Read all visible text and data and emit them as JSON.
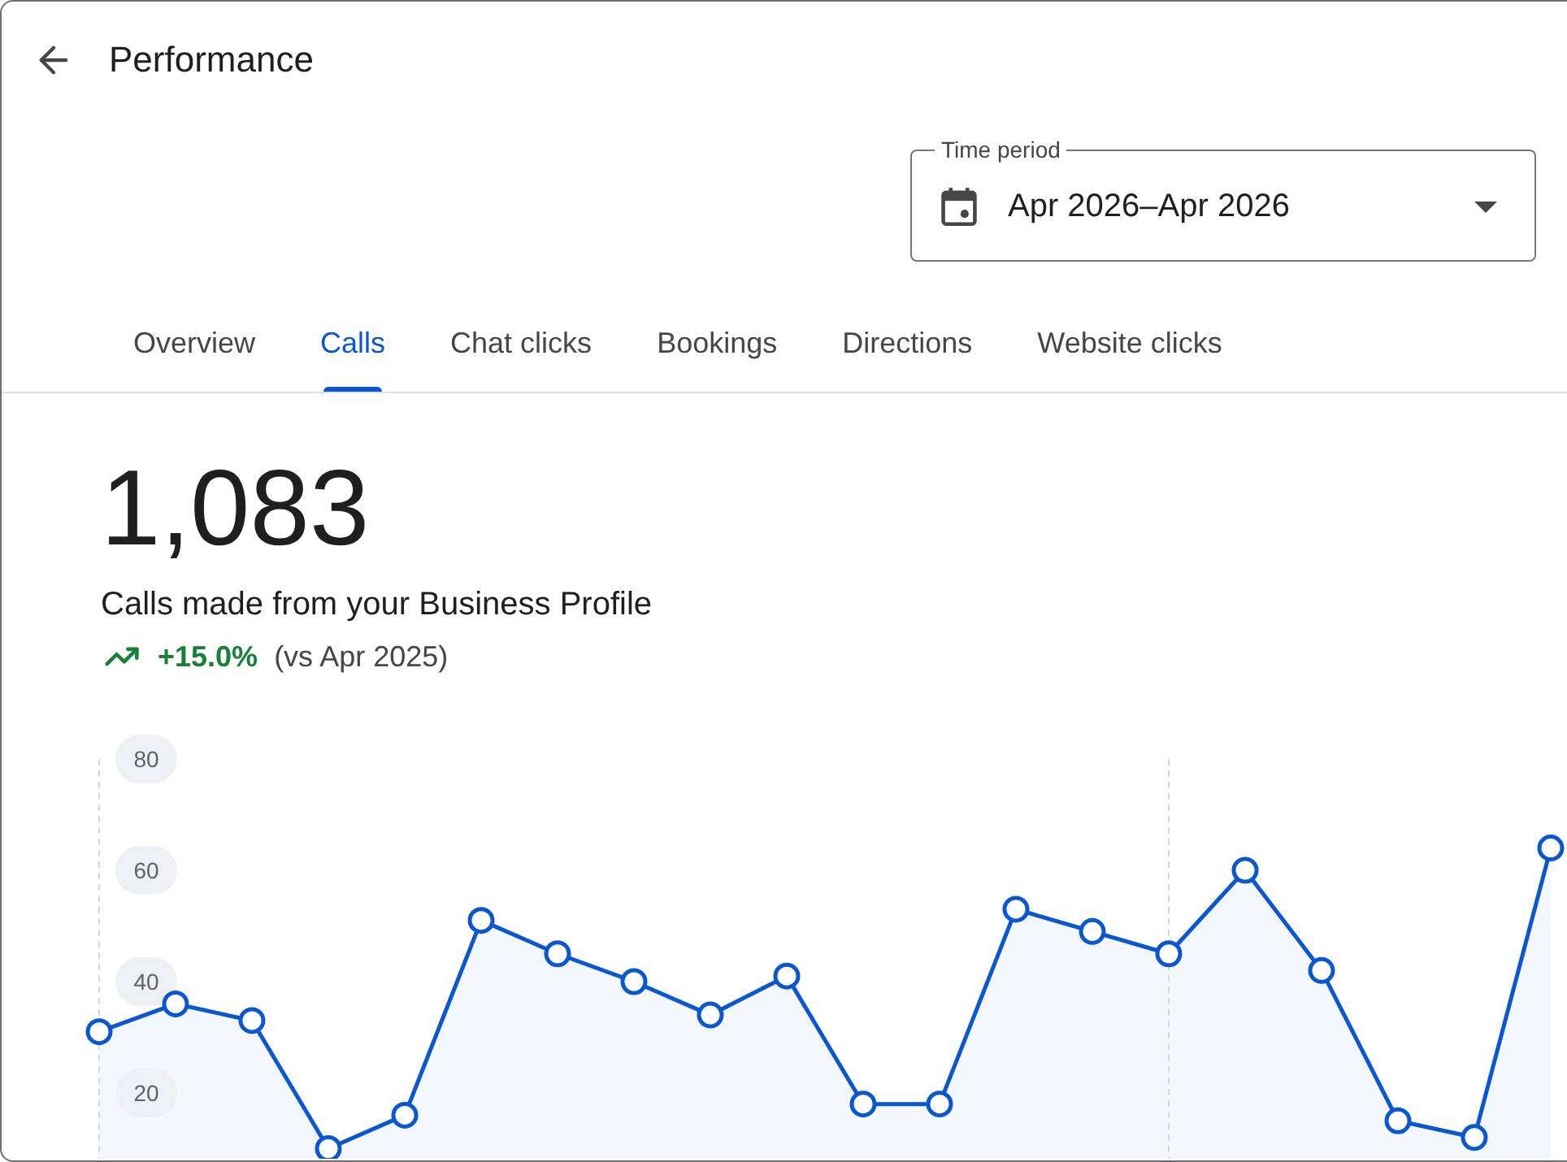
{
  "header": {
    "title": "Performance"
  },
  "time_period": {
    "label": "Time period",
    "value": "Apr 2026–Apr 2026"
  },
  "tabs": [
    {
      "label": "Overview",
      "selected": false
    },
    {
      "label": "Calls",
      "selected": true
    },
    {
      "label": "Chat clicks",
      "selected": false
    },
    {
      "label": "Bookings",
      "selected": false
    },
    {
      "label": "Directions",
      "selected": false
    },
    {
      "label": "Website clicks",
      "selected": false
    }
  ],
  "summary": {
    "total": "1,083",
    "description": "Calls made from your Business Profile",
    "positive": true,
    "change": "+15.0%",
    "comparison": "(vs Apr 2025)"
  },
  "chart": {
    "chart_data": {
      "type": "area",
      "categories": [
        null,
        null,
        null,
        null,
        null,
        null,
        null,
        null,
        null,
        null,
        null,
        null,
        null,
        null,
        null,
        null,
        null,
        null,
        null,
        null
      ],
      "ylim": [
        0,
        80
      ],
      "yticks": [
        {
          "value": 20,
          "label": "20"
        },
        {
          "value": 40,
          "label": "40"
        },
        {
          "value": 60,
          "label": "60"
        },
        {
          "value": 80,
          "label": "80"
        }
      ],
      "series": [
        {
          "color": "#0b57d0",
          "values": [
            31,
            36,
            33,
            10,
            16,
            51,
            45,
            40,
            34,
            41,
            18,
            18,
            53,
            49,
            45,
            60,
            42,
            15,
            12,
            64
          ]
        }
      ]
    }
  }
}
